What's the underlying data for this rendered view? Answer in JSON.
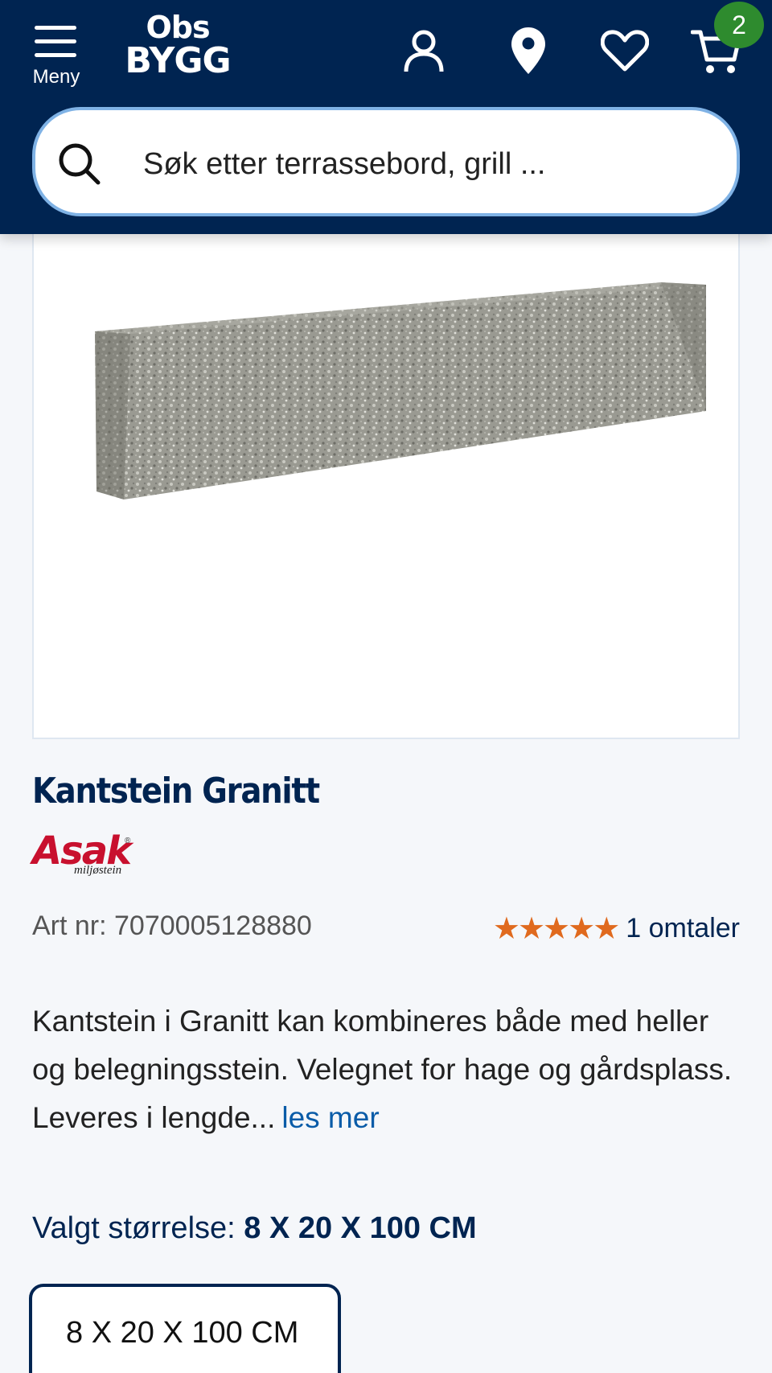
{
  "header": {
    "menu_label": "Meny",
    "logo_line1": "Obs",
    "logo_line2": "BYGG",
    "cart_count": "2",
    "search_placeholder": "Søk etter terrassebord, grill ..."
  },
  "product": {
    "title": "Kantstein Granitt",
    "brand_name": "Asak",
    "brand_reg": "®",
    "brand_sub": "miljøstein",
    "art_nr": "Art nr: 7070005128880",
    "stars": "★★★★★",
    "rating_value": 5,
    "reviews": "1 omtaler",
    "description": "Kantstein i Granitt kan kombineres både med heller og belegningsstein. Velegnet for hage og gårdsplass. Leveres i lengde...",
    "read_more": "les mer",
    "size_label": "Valgt størrelse:",
    "size_value": "8 X 20 X 100 CM",
    "size_option": "8 X 20 X 100 CM"
  },
  "colors": {
    "header_bg": "#002451",
    "accent_blue": "#0a5ca8",
    "star": "#e06a1e",
    "badge": "#2e8b2e",
    "brand_red": "#c8102e"
  },
  "icons": [
    "menu-icon",
    "account-icon",
    "location-icon",
    "heart-icon",
    "cart-icon",
    "search-icon"
  ]
}
